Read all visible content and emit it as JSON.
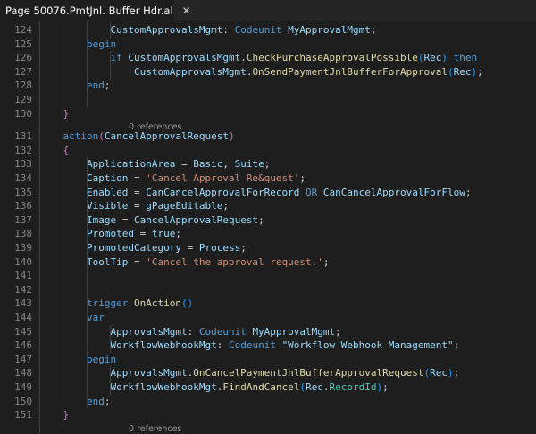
{
  "tab": {
    "title": "Page 50076.PmtJnl. Buffer Hdr.al",
    "close_glyph": "✕"
  },
  "code_lens": {
    "first": "0 references",
    "second": "0 references"
  },
  "lines": [
    {
      "n": "124",
      "tokens": [
        {
          "t": "            "
        },
        {
          "t": "CustomApprovalsMgmt",
          "c": "id"
        },
        {
          "t": ": "
        },
        {
          "t": "Codeunit",
          "c": "kw"
        },
        {
          "t": " "
        },
        {
          "t": "MyApprovalMgmt",
          "c": "id"
        },
        {
          "t": ";"
        }
      ]
    },
    {
      "n": "125",
      "tokens": [
        {
          "t": "        "
        },
        {
          "t": "begin",
          "c": "kw"
        }
      ]
    },
    {
      "n": "126",
      "tokens": [
        {
          "t": "            "
        },
        {
          "t": "if",
          "c": "kw"
        },
        {
          "t": " "
        },
        {
          "t": "CustomApprovalsMgmt",
          "c": "id"
        },
        {
          "t": "."
        },
        {
          "t": "CheckPurchaseApprovalPossible",
          "c": "fn"
        },
        {
          "t": "(",
          "c": "bb"
        },
        {
          "t": "Rec",
          "c": "id"
        },
        {
          "t": ")",
          "c": "bb"
        },
        {
          "t": " "
        },
        {
          "t": "then",
          "c": "kw"
        }
      ]
    },
    {
      "n": "127",
      "tokens": [
        {
          "t": "                "
        },
        {
          "t": "CustomApprovalsMgmt",
          "c": "id"
        },
        {
          "t": "."
        },
        {
          "t": "OnSendPaymentJnlBufferForApproval",
          "c": "fn"
        },
        {
          "t": "(",
          "c": "bb"
        },
        {
          "t": "Rec",
          "c": "id"
        },
        {
          "t": ")",
          "c": "bb"
        },
        {
          "t": ";"
        }
      ]
    },
    {
      "n": "128",
      "tokens": [
        {
          "t": "        "
        },
        {
          "t": "end",
          "c": "kw"
        },
        {
          "t": ";"
        }
      ]
    },
    {
      "n": "129",
      "tokens": []
    },
    {
      "n": "130",
      "tokens": [
        {
          "t": "    "
        },
        {
          "t": "}",
          "c": "br"
        }
      ]
    },
    {
      "n": "131",
      "tokens": [
        {
          "t": "    "
        },
        {
          "t": "action",
          "c": "kw"
        },
        {
          "t": "(",
          "c": "br"
        },
        {
          "t": "CancelApprovalRequest",
          "c": "id"
        },
        {
          "t": ")",
          "c": "br"
        }
      ]
    },
    {
      "n": "132",
      "tokens": [
        {
          "t": "    "
        },
        {
          "t": "{",
          "c": "br"
        }
      ]
    },
    {
      "n": "133",
      "tokens": [
        {
          "t": "        "
        },
        {
          "t": "ApplicationArea",
          "c": "id"
        },
        {
          "t": " = "
        },
        {
          "t": "Basic",
          "c": "id"
        },
        {
          "t": ", "
        },
        {
          "t": "Suite",
          "c": "id"
        },
        {
          "t": ";"
        }
      ]
    },
    {
      "n": "134",
      "tokens": [
        {
          "t": "        "
        },
        {
          "t": "Caption",
          "c": "id"
        },
        {
          "t": " = "
        },
        {
          "t": "'Cancel Approval Re&quest'",
          "c": "st"
        },
        {
          "t": ";"
        }
      ]
    },
    {
      "n": "135",
      "tokens": [
        {
          "t": "        "
        },
        {
          "t": "Enabled",
          "c": "id"
        },
        {
          "t": " = "
        },
        {
          "t": "CanCancelApprovalForRecord",
          "c": "id"
        },
        {
          "t": " "
        },
        {
          "t": "OR",
          "c": "kw"
        },
        {
          "t": " "
        },
        {
          "t": "CanCancelApprovalForFlow",
          "c": "id"
        },
        {
          "t": ";"
        }
      ]
    },
    {
      "n": "136",
      "tokens": [
        {
          "t": "        "
        },
        {
          "t": "Visible",
          "c": "id"
        },
        {
          "t": " = "
        },
        {
          "t": "gPageEditable",
          "c": "id"
        },
        {
          "t": ";"
        }
      ]
    },
    {
      "n": "137",
      "tokens": [
        {
          "t": "        "
        },
        {
          "t": "Image",
          "c": "id"
        },
        {
          "t": " = "
        },
        {
          "t": "CancelApprovalRequest",
          "c": "id"
        },
        {
          "t": ";"
        }
      ]
    },
    {
      "n": "138",
      "tokens": [
        {
          "t": "        "
        },
        {
          "t": "Promoted",
          "c": "id"
        },
        {
          "t": " = "
        },
        {
          "t": "true",
          "c": "id"
        },
        {
          "t": ";"
        }
      ]
    },
    {
      "n": "139",
      "tokens": [
        {
          "t": "        "
        },
        {
          "t": "PromotedCategory",
          "c": "id"
        },
        {
          "t": " = "
        },
        {
          "t": "Process",
          "c": "id"
        },
        {
          "t": ";"
        }
      ]
    },
    {
      "n": "140",
      "tokens": [
        {
          "t": "        "
        },
        {
          "t": "ToolTip",
          "c": "id"
        },
        {
          "t": " = "
        },
        {
          "t": "'Cancel the approval request.'",
          "c": "st"
        },
        {
          "t": ";"
        }
      ]
    },
    {
      "n": "141",
      "tokens": []
    },
    {
      "n": "142",
      "tokens": []
    },
    {
      "n": "143",
      "tokens": [
        {
          "t": "        "
        },
        {
          "t": "trigger",
          "c": "kw"
        },
        {
          "t": " "
        },
        {
          "t": "OnAction",
          "c": "fn"
        },
        {
          "t": "()",
          "c": "bb"
        }
      ]
    },
    {
      "n": "144",
      "tokens": [
        {
          "t": "        "
        },
        {
          "t": "var",
          "c": "kw"
        }
      ]
    },
    {
      "n": "145",
      "tokens": [
        {
          "t": "            "
        },
        {
          "t": "ApprovalsMgmt",
          "c": "id"
        },
        {
          "t": ": "
        },
        {
          "t": "Codeunit",
          "c": "kw"
        },
        {
          "t": " "
        },
        {
          "t": "MyApprovalMgmt",
          "c": "id"
        },
        {
          "t": ";"
        }
      ]
    },
    {
      "n": "146",
      "tokens": [
        {
          "t": "            "
        },
        {
          "t": "WorkflowWebhookMgt",
          "c": "id"
        },
        {
          "t": ": "
        },
        {
          "t": "Codeunit",
          "c": "kw"
        },
        {
          "t": " "
        },
        {
          "t": "\"Workflow Webhook Management\"",
          "c": "id"
        },
        {
          "t": ";"
        }
      ]
    },
    {
      "n": "147",
      "tokens": [
        {
          "t": "        "
        },
        {
          "t": "begin",
          "c": "kw"
        }
      ]
    },
    {
      "n": "148",
      "tokens": [
        {
          "t": "            "
        },
        {
          "t": "ApprovalsMgmt",
          "c": "id"
        },
        {
          "t": "."
        },
        {
          "t": "OnCancelPaymentJnlBufferApprovalRequest",
          "c": "fn"
        },
        {
          "t": "(",
          "c": "bb"
        },
        {
          "t": "Rec",
          "c": "id"
        },
        {
          "t": ")",
          "c": "bb"
        },
        {
          "t": ";"
        }
      ]
    },
    {
      "n": "149",
      "tokens": [
        {
          "t": "            "
        },
        {
          "t": "WorkflowWebhookMgt",
          "c": "id"
        },
        {
          "t": "."
        },
        {
          "t": "FindAndCancel",
          "c": "fn"
        },
        {
          "t": "(",
          "c": "bb"
        },
        {
          "t": "Rec",
          "c": "id"
        },
        {
          "t": "."
        },
        {
          "t": "RecordId",
          "c": "ty"
        },
        {
          "t": ")",
          "c": "bb"
        },
        {
          "t": ";"
        }
      ]
    },
    {
      "n": "150",
      "tokens": [
        {
          "t": "        "
        },
        {
          "t": "end",
          "c": "kw"
        },
        {
          "t": ";"
        }
      ]
    },
    {
      "n": "151",
      "tokens": [
        {
          "t": "    "
        },
        {
          "t": "}",
          "c": "br"
        }
      ]
    }
  ]
}
